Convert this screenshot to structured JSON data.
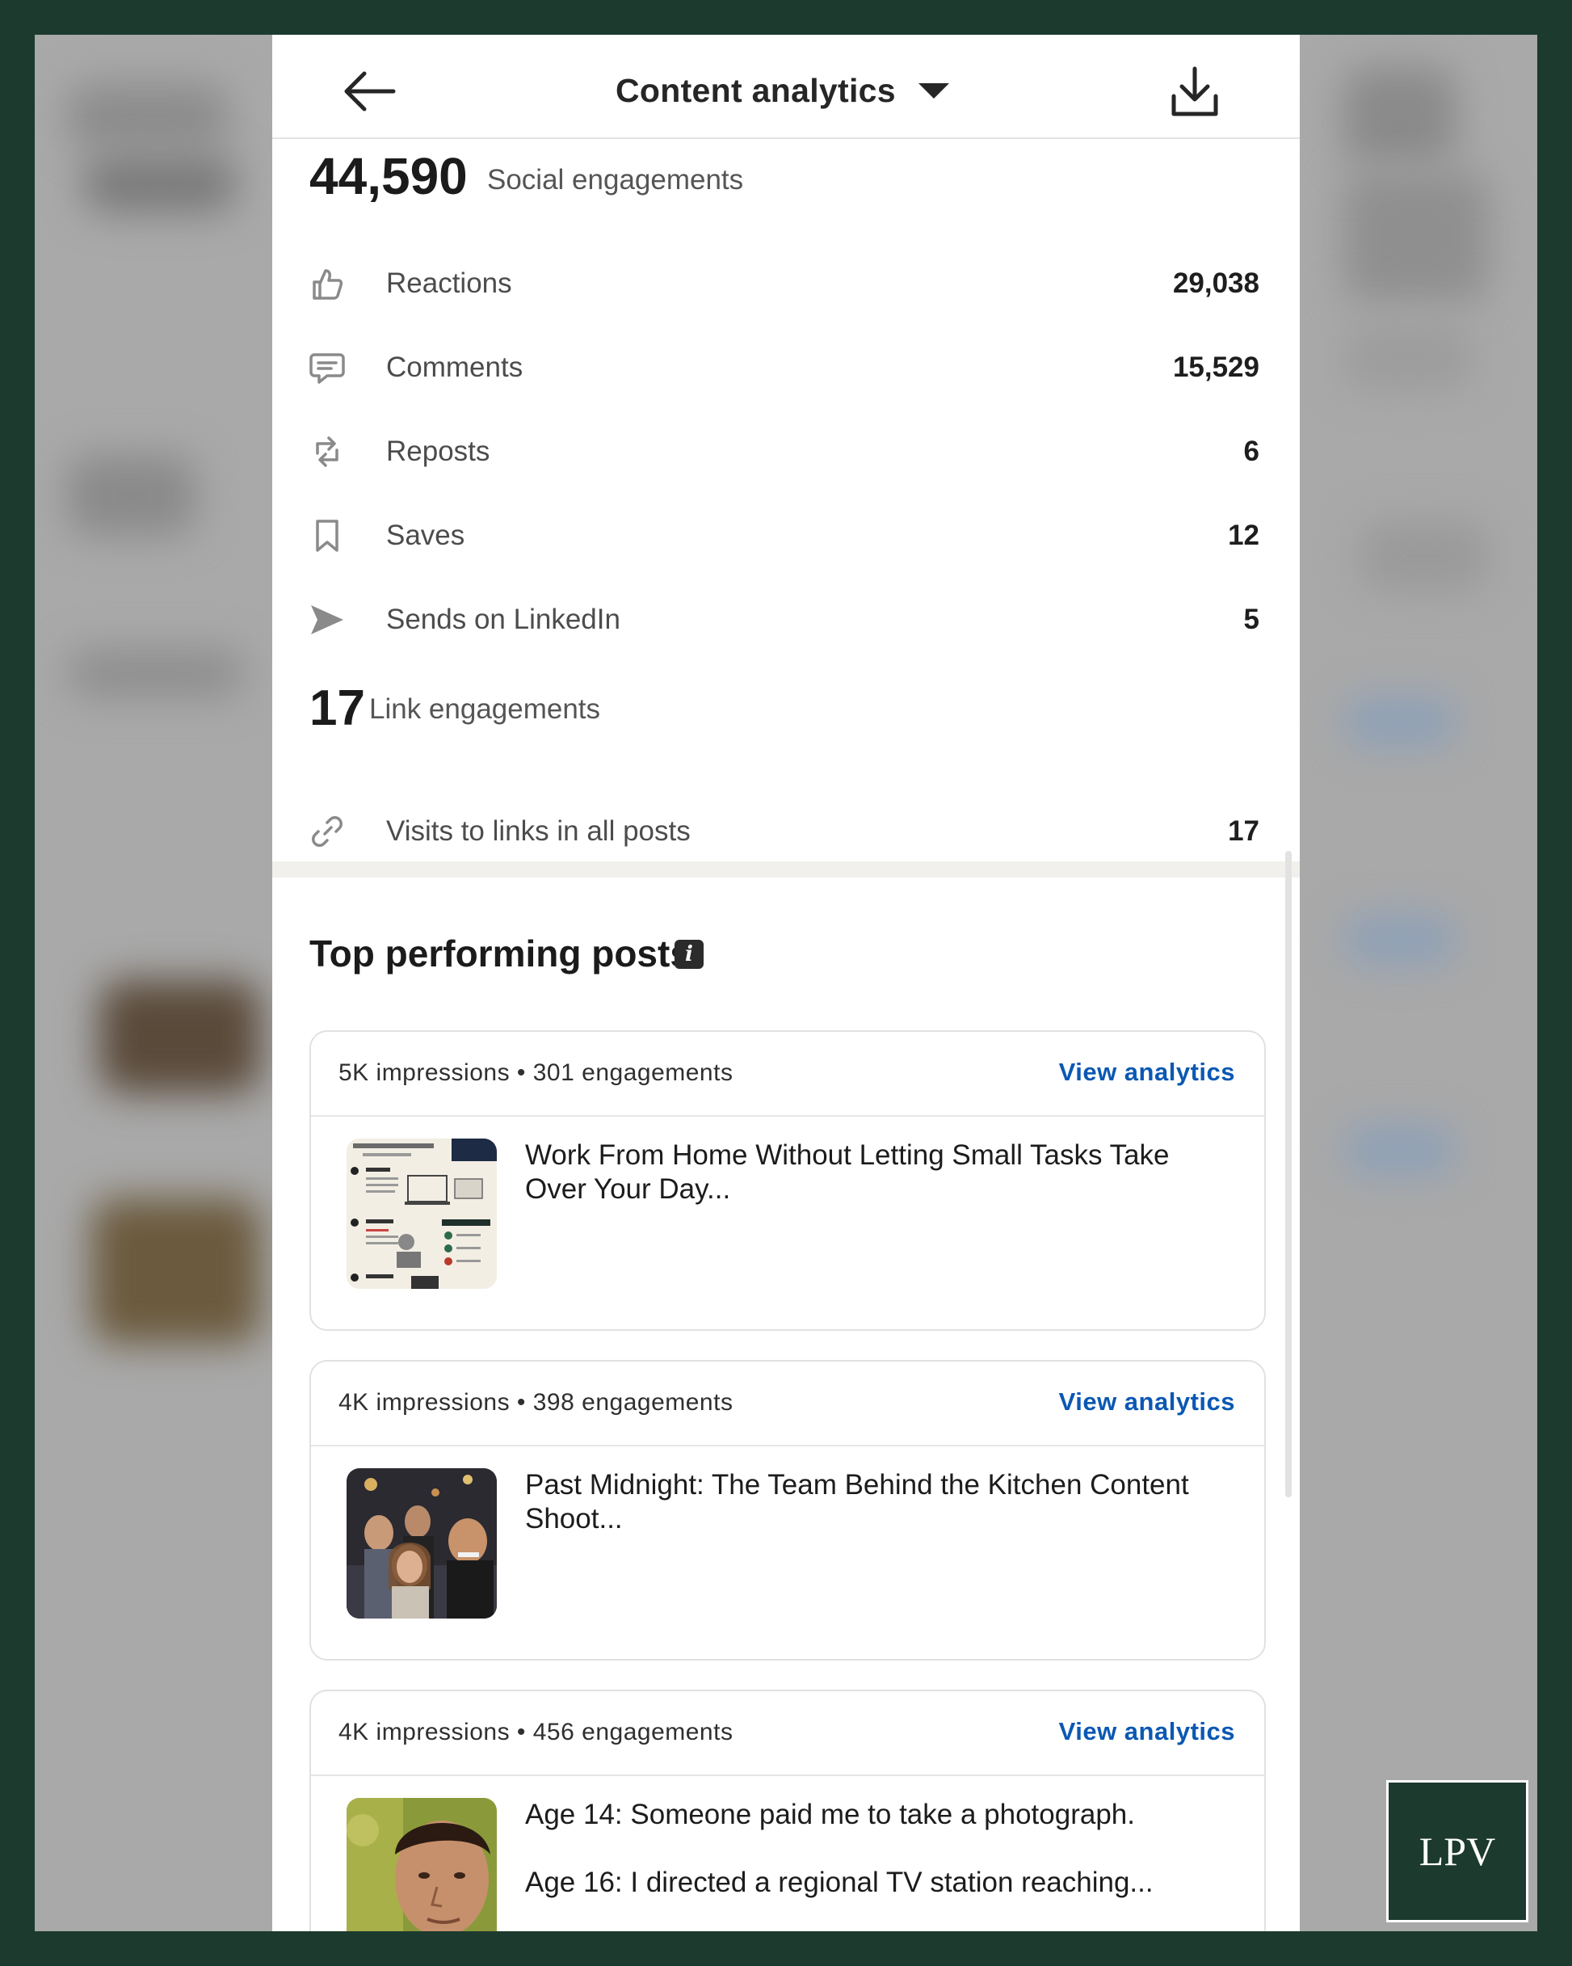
{
  "header": {
    "title": "Content analytics"
  },
  "social": {
    "total": "44,590",
    "total_label": "Social engagements",
    "rows": [
      {
        "label": "Reactions",
        "value": "29,038",
        "icon": "thumbs-up-icon"
      },
      {
        "label": "Comments",
        "value": "15,529",
        "icon": "comment-icon"
      },
      {
        "label": "Reposts",
        "value": "6",
        "icon": "repost-icon"
      },
      {
        "label": "Saves",
        "value": "12",
        "icon": "bookmark-icon"
      },
      {
        "label": "Sends on LinkedIn",
        "value": "5",
        "icon": "send-icon"
      }
    ]
  },
  "links": {
    "total": "17",
    "total_label": "Link engagements",
    "rows": [
      {
        "label": "Visits to links in all posts",
        "value": "17",
        "icon": "link-icon"
      }
    ]
  },
  "top_posts": {
    "title": "Top performing posts",
    "view_label": "View analytics",
    "posts": [
      {
        "stats": "5K impressions • 301 engagements",
        "text": "Work From Home Without Letting Small Tasks Take Over Your Day...",
        "thumb": "infographic-thumbnail"
      },
      {
        "stats": "4K impressions • 398 engagements",
        "text": "Past Midnight: The Team Behind the Kitchen Content Shoot...",
        "thumb": "group-photo-thumbnail"
      },
      {
        "stats": "4K impressions • 456 engagements",
        "text": "Age 14: Someone paid me to take a photograph.",
        "text2": "Age 16: I directed a regional TV station reaching...",
        "thumb": "portrait-thumbnail"
      }
    ]
  },
  "watermark": {
    "text": "LPV"
  }
}
